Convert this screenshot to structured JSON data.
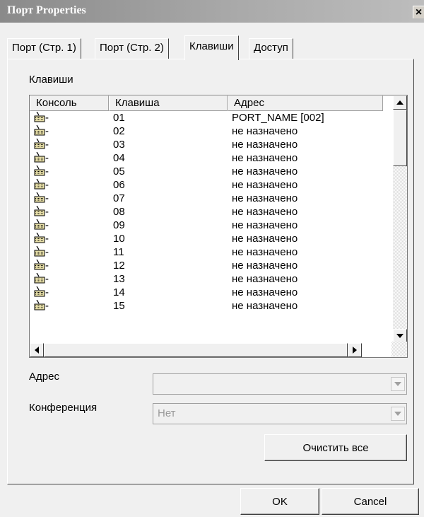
{
  "window": {
    "title": "Порт Properties",
    "close_label": "×"
  },
  "tabs": [
    {
      "label": "Порт (Стр. 1)",
      "active": false
    },
    {
      "label": "Порт (Стр. 2)",
      "active": false
    },
    {
      "label": "Клавиши",
      "active": true
    },
    {
      "label": "Доступ",
      "active": false
    }
  ],
  "keys_group": {
    "label": "Клавиши"
  },
  "listview": {
    "columns": [
      "Консоль",
      "Клавиша",
      "Адрес"
    ],
    "rows": [
      {
        "icon": "keyboard-icon",
        "console": "-",
        "key": "01",
        "address": "PORT_NAME [002]"
      },
      {
        "icon": "keyboard-icon",
        "console": "-",
        "key": "02",
        "address": "не назначено"
      },
      {
        "icon": "keyboard-icon",
        "console": "-",
        "key": "03",
        "address": "не назначено"
      },
      {
        "icon": "keyboard-icon",
        "console": "-",
        "key": "04",
        "address": "не назначено"
      },
      {
        "icon": "keyboard-icon",
        "console": "-",
        "key": "05",
        "address": "не назначено"
      },
      {
        "icon": "keyboard-icon",
        "console": "-",
        "key": "06",
        "address": "не назначено"
      },
      {
        "icon": "keyboard-icon",
        "console": "-",
        "key": "07",
        "address": "не назначено"
      },
      {
        "icon": "keyboard-icon",
        "console": "-",
        "key": "08",
        "address": "не назначено"
      },
      {
        "icon": "keyboard-icon",
        "console": "-",
        "key": "09",
        "address": "не назначено"
      },
      {
        "icon": "keyboard-icon",
        "console": "-",
        "key": "10",
        "address": "не назначено"
      },
      {
        "icon": "keyboard-icon",
        "console": "-",
        "key": "11",
        "address": "не назначено"
      },
      {
        "icon": "keyboard-icon",
        "console": "-",
        "key": "12",
        "address": "не назначено"
      },
      {
        "icon": "keyboard-icon",
        "console": "-",
        "key": "13",
        "address": "не назначено"
      },
      {
        "icon": "keyboard-icon",
        "console": "-",
        "key": "14",
        "address": "не назначено"
      },
      {
        "icon": "keyboard-icon",
        "console": "-",
        "key": "15",
        "address": "не назначено"
      }
    ]
  },
  "address_field": {
    "label": "Адрес",
    "value": ""
  },
  "conference_field": {
    "label": "Конференция",
    "value": "Нет"
  },
  "buttons": {
    "clear_all": "Очистить все",
    "ok": "OK",
    "cancel": "Cancel"
  }
}
